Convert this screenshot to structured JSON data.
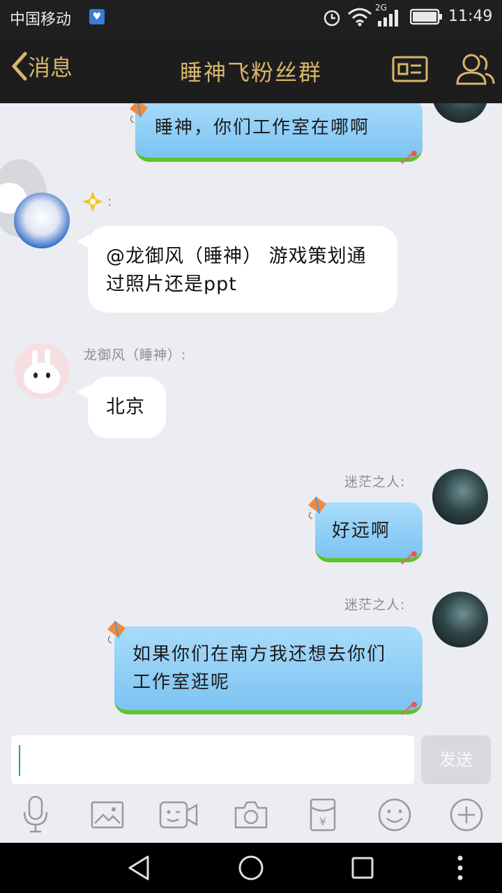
{
  "status": {
    "carrier": "中国移动",
    "network": "2G",
    "time": "11:49"
  },
  "header": {
    "back_label": "消息",
    "title": "睡神飞粉丝群"
  },
  "messages": [
    {
      "side": "right",
      "text": "睡神，你们工作室在哪啊"
    },
    {
      "side": "left",
      "sender": ":",
      "text": "@龙御风（睡神） 游戏策划通过照片还是ppt"
    },
    {
      "side": "left",
      "sender": "龙御风（睡神）:",
      "text": "北京"
    },
    {
      "side": "right",
      "sender": "迷茫之人:",
      "text": "好远啊"
    },
    {
      "side": "right",
      "sender": "迷茫之人:",
      "text": "如果你们在南方我还想去你们工作室逛呢"
    }
  ],
  "input": {
    "value": "",
    "send_label": "发送"
  },
  "toolbar": [
    "microphone-icon",
    "image-icon",
    "video-call-icon",
    "camera-icon",
    "red-packet-icon",
    "emoji-icon",
    "plus-icon"
  ],
  "colors": {
    "accent_gold": "#d8b56a",
    "bubble_blue": "#8fcdf5",
    "bubble_green_border": "#5cc42d"
  }
}
